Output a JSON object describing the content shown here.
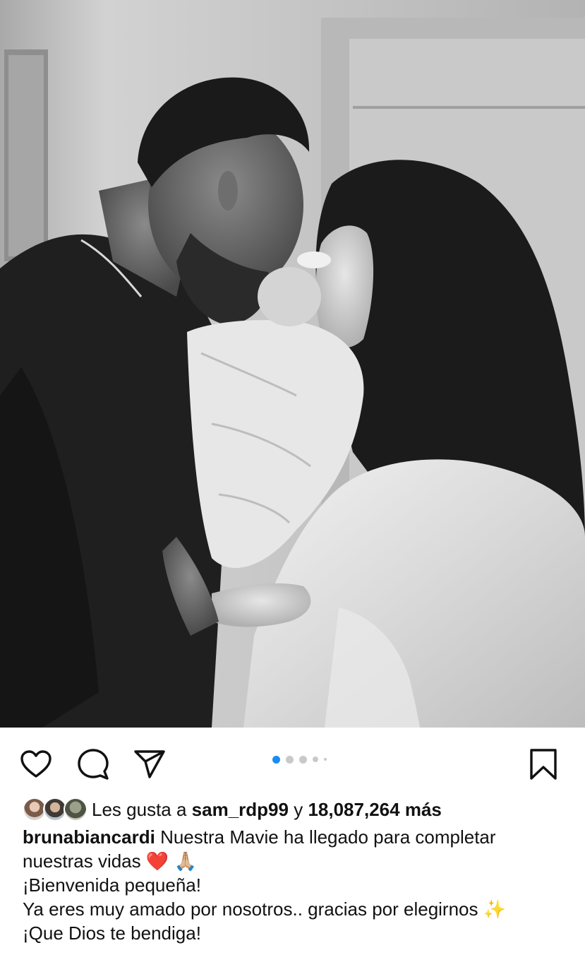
{
  "post": {
    "photo_alt": "Black and white photo of a couple kissing their newborn baby",
    "carousel": {
      "total": 5,
      "active": 1
    },
    "actions": {
      "like_icon": "heart-icon",
      "comment_icon": "comment-icon",
      "share_icon": "paper-plane-icon",
      "save_icon": "bookmark-icon"
    },
    "likes": {
      "prefix": "Les gusta a",
      "user": "sam_rdp99",
      "conjunction": "y",
      "count": "18,087,264",
      "suffix": "más"
    },
    "caption": {
      "username": "brunabiancardi",
      "line1": "Nuestra Mavie ha llegado para completar nuestras vidas",
      "emoji1": "❤️",
      "emoji2": "🙏🏼",
      "line2": "¡Bienvenida pequeña!",
      "line3": "Ya eres muy amado por nosotros.. gracias por elegirnos",
      "emoji3": "✨",
      "line4": "¡Que Dios te bendiga!"
    },
    "colors": {
      "accent_dot": "#1a8cf0",
      "inactive_dot": "#c9c9c9",
      "text": "#111111"
    }
  }
}
